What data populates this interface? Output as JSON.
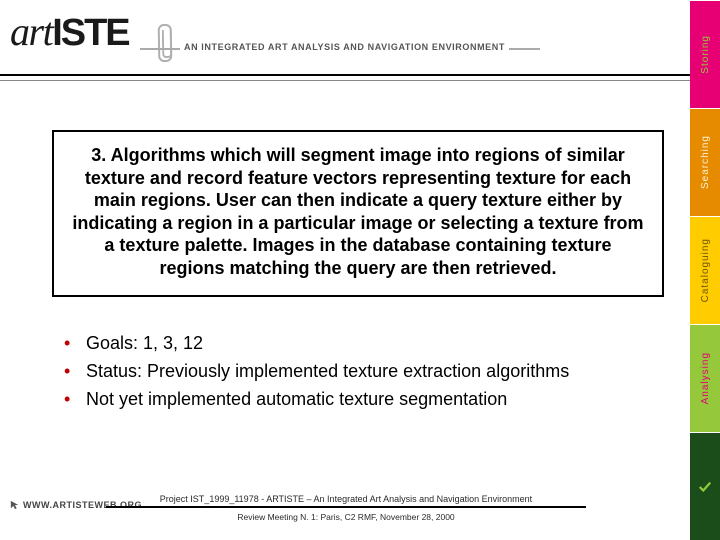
{
  "logo": {
    "part1": "art",
    "part2": "ISTE",
    "tagline": "AN INTEGRATED ART ANALYSIS AND NAVIGATION ENVIRONMENT"
  },
  "sidebar": {
    "items": [
      {
        "label": "Storing"
      },
      {
        "label": "Searching"
      },
      {
        "label": "Cataloguing"
      },
      {
        "label": "Analysing"
      }
    ]
  },
  "main": {
    "paragraph": "3. Algorithms which will segment  image into regions of similar texture  and record feature vectors representing  texture for each main regions. User can then indicate a query texture either by indicating a region in a particular image or selecting a texture from a texture palette. Images in the database containing texture regions matching the query are then retrieved."
  },
  "bullets": [
    {
      "text": "Goals: 1, 3, 12"
    },
    {
      "text": "Status: Previously implemented texture extraction algorithms"
    },
    {
      "text": "Not yet implemented automatic texture segmentation"
    }
  ],
  "footer": {
    "line1": "Project IST_1999_11978 - ARTISTE – An Integrated Art Analysis and Navigation Environment",
    "line2": "Review Meeting N. 1:  Paris, C2 RMF, November 28, 2000",
    "url": "WWW.ARTISTEWEB.ORG"
  }
}
